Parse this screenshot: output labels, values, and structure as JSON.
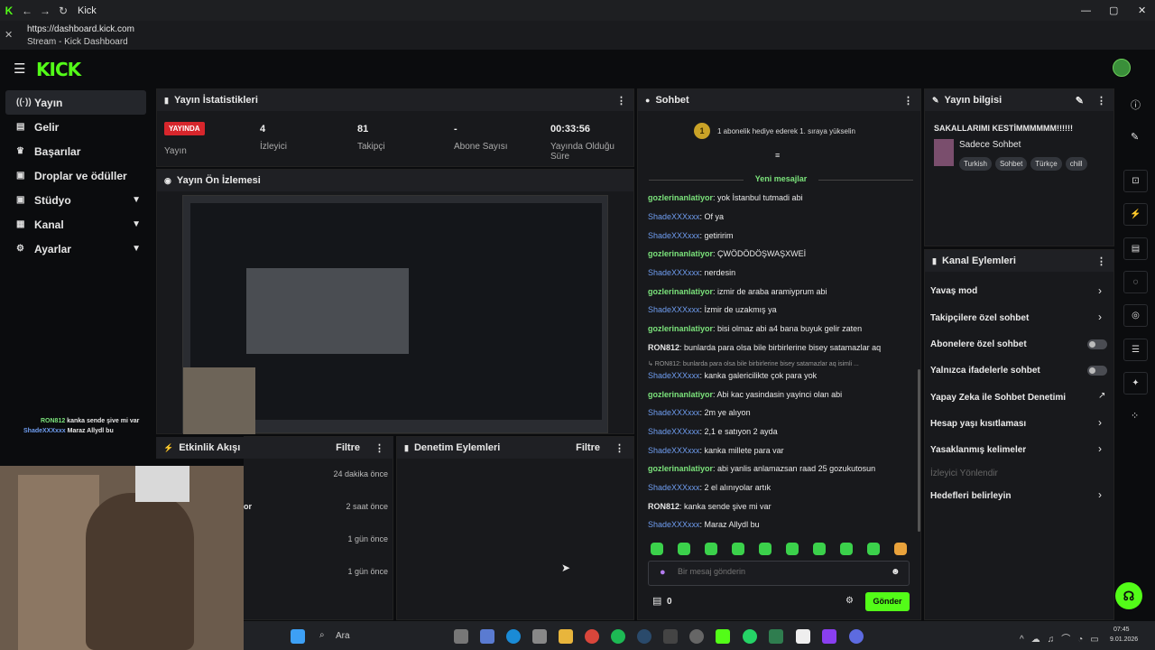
{
  "window": {
    "title": "Kick",
    "url": "https://dashboard.kick.com",
    "page_title": "Stream - Kick Dashboard"
  },
  "brand": {
    "logo": "KICK",
    "accent": "#53fc18"
  },
  "sidebar": {
    "items": [
      {
        "label": "Yayın",
        "icon": "signal-icon"
      },
      {
        "label": "Gelir",
        "icon": "wallet-icon"
      },
      {
        "label": "Başarılar",
        "icon": "trophy-icon"
      },
      {
        "label": "Droplar ve ödüller",
        "icon": "gift-icon"
      },
      {
        "label": "Stüdyo",
        "icon": "gift-icon"
      },
      {
        "label": "Kanal",
        "icon": "grid-icon"
      },
      {
        "label": "Ayarlar",
        "icon": "gear-icon"
      }
    ]
  },
  "overlay": {
    "line1_user": "RON812",
    "line1_text": " kanka sende şive mi var",
    "line2_user": "ShadeXXXxxx",
    "line2_text": " Maraz Allydl bu"
  },
  "stats": {
    "title": "Yayın İstatistikleri",
    "live_badge": "YAYINDA",
    "live_label": "Yayın",
    "viewers_value": "4",
    "viewers_label": "İzleyici",
    "followers_value": "81",
    "followers_label": "Takipçi",
    "subs_value": "-",
    "subs_label": "Abone Sayısı",
    "time_value": "00:33:56",
    "time_label": "Yayında Olduğu Süre"
  },
  "preview": {
    "title": "Yayın Ön İzlemesi"
  },
  "activity": {
    "title": "Etkinlik Akışı",
    "filter": "Filtre",
    "rows": [
      {
        "text": "",
        "time": "24 dakika önce"
      },
      {
        "text": "or",
        "time": "2 saat önce"
      },
      {
        "text": "",
        "time": "1 gün önce"
      },
      {
        "text": "",
        "time": "1 gün önce"
      }
    ]
  },
  "moderation": {
    "title": "Denetim Eylemleri",
    "filter": "Filtre"
  },
  "chat": {
    "title": "Sohbet",
    "gift_number": "1",
    "gift_text": "1 abonelik hediye ederek 1. sıraya yükselin",
    "new_messages": "Yeni mesajlar",
    "messages": [
      {
        "user": "gozlerinanlatiyor",
        "text": ": yok İstanbul tutmadi abi",
        "type": "u1"
      },
      {
        "user": "ShadeXXXxxx",
        "text": ": Of ya",
        "type": "u2"
      },
      {
        "user": "ShadeXXXxxx",
        "text": ": getiririm",
        "type": "u2"
      },
      {
        "user": "gozlerinanlatiyor",
        "text": ": ÇWÖDÖDÖŞWAŞXWEİ",
        "type": "u1"
      },
      {
        "user": "ShadeXXXxxx",
        "text": ": nerdesin",
        "type": "u2"
      },
      {
        "user": "gozlerinanlatiyor",
        "text": ": izmir de araba aramiyprum abi",
        "type": "u1"
      },
      {
        "user": "ShadeXXXxxx",
        "text": ": İzmir de uzakmış ya",
        "type": "u2"
      },
      {
        "user": "gozlerinanlatiyor",
        "text": ": bisi olmaz abi a4 bana buyuk gelir zaten",
        "type": "u1"
      },
      {
        "user": "RON812",
        "text": ": bunlarda para olsa bile birbirlerine bisey satamazlar aq",
        "type": "u3"
      },
      {
        "user": "ShadeXXXxxx",
        "text": ": kanka galericilikte çok para yok",
        "type": "u2"
      },
      {
        "user": "gozlerinanlatiyor",
        "text": ": Abi kac yasindasin yayinci olan abi",
        "type": "u1"
      },
      {
        "user": "ShadeXXXxxx",
        "text": ": 2m ye alıyon",
        "type": "u2"
      },
      {
        "user": "ShadeXXXxxx",
        "text": ": 2,1 e satıyon 2 ayda",
        "type": "u2"
      },
      {
        "user": "ShadeXXXxxx",
        "text": ": kanka millete para var",
        "type": "u2"
      },
      {
        "user": "gozlerinanlatiyor",
        "text": ": abi yanlis anlamazsan raad 25 gozukutosun",
        "type": "u1"
      },
      {
        "user": "ShadeXXXxxx",
        "text": ": 2 el alınıyolar artık",
        "type": "u2"
      },
      {
        "user": "RON812",
        "text": ": kanka sende şive mi var",
        "type": "u3"
      },
      {
        "user": "ShadeXXXxxx",
        "text": ": Maraz Allydl bu",
        "type": "u2"
      }
    ],
    "reply_preview": "↳ RON812: bunlarda para olsa bile birbirlerine bisey satamazlar aq isimli ...",
    "input_placeholder": "Bir mesaj gönderin",
    "points": "0",
    "send_label": "Gönder"
  },
  "stream_info": {
    "title": "Yayın bilgisi",
    "stream_title": "SAKALLARIMI KESTİMMMMMM!!!!!!",
    "category": "Sadece Sohbet",
    "tags": [
      "Turkish",
      "Sohbet",
      "Türkçe",
      "chill"
    ]
  },
  "channel_actions": {
    "title": "Kanal Eylemleri",
    "items": [
      {
        "label": "Yavaş mod",
        "control": "chevron"
      },
      {
        "label": "Takipçilere özel sohbet",
        "control": "chevron"
      },
      {
        "label": "Abonelere özel sohbet",
        "control": "toggle"
      },
      {
        "label": "Yalnızca ifadelerle sohbet",
        "control": "toggle"
      },
      {
        "label": "Yapay Zeka ile Sohbet Denetimi",
        "control": "external"
      },
      {
        "label": "Hesap yaşı kısıtlaması",
        "control": "chevron"
      },
      {
        "label": "Yasaklanmış kelimeler",
        "control": "chevron"
      },
      {
        "label": "İzleyici Yönlendir",
        "control": "none"
      },
      {
        "label": "Hedefleri belirleyin",
        "control": "chevron"
      }
    ]
  },
  "taskbar": {
    "search_placeholder": "Ara",
    "time": "07:45",
    "date": "9.01.2026"
  }
}
